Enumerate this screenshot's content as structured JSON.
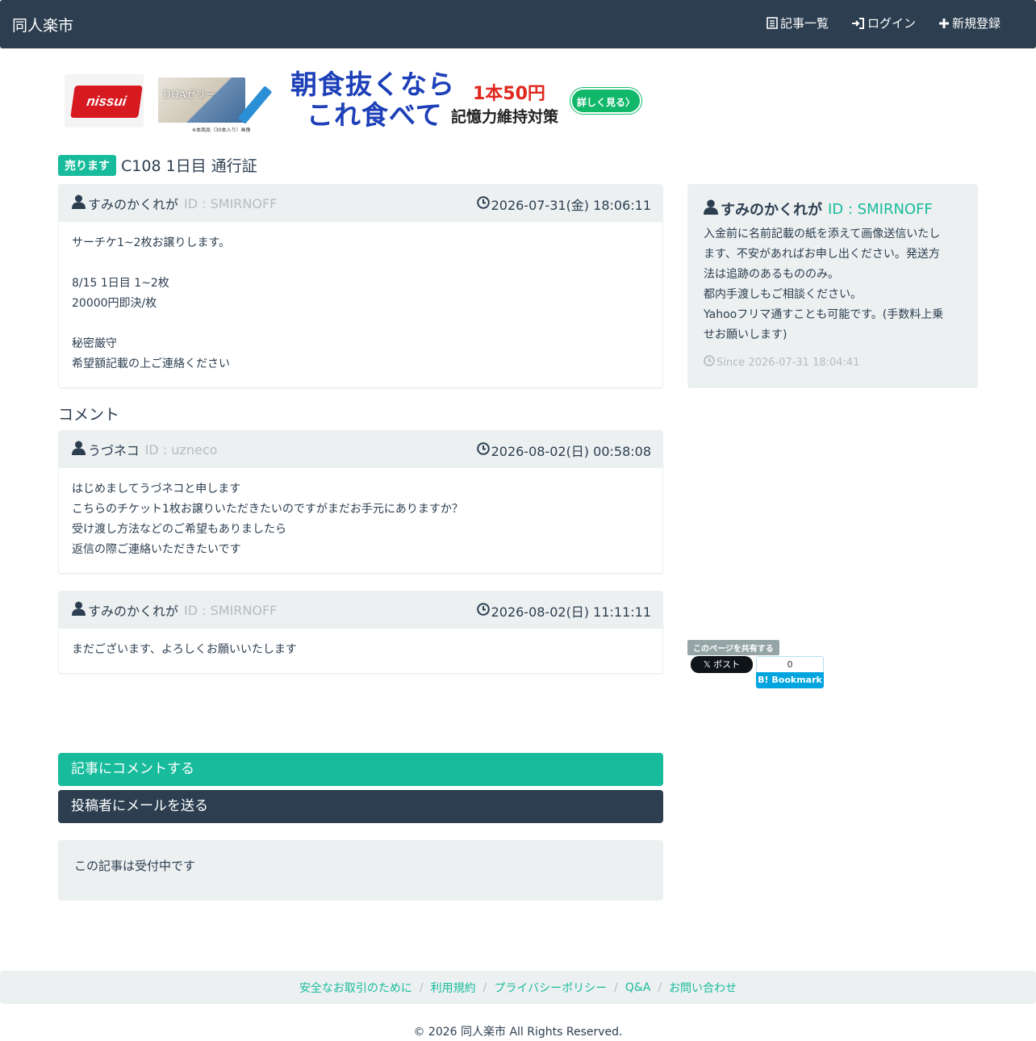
{
  "header": {
    "brand": "同人楽市",
    "nav": [
      {
        "label": "記事一覧",
        "icon": "list-icon"
      },
      {
        "label": "ログイン",
        "icon": "login-icon"
      },
      {
        "label": "新規登録",
        "icon": "plus-icon"
      }
    ]
  },
  "ad": {
    "logo_text": "nissui",
    "product_text": "DHAゼリー",
    "product_note": "※本商品（30本入り）画像",
    "headline_line1": "朝食抜くなら",
    "headline_line2": "これ食べて",
    "price": "1本50円",
    "subcopy": "記憶力維持対策",
    "cta": "詳しく見る〉"
  },
  "post": {
    "badge": "売ります",
    "title": "C108 1日目 通行証",
    "author": "すみのかくれが",
    "author_id": "ID : SMIRNOFF",
    "date": "2026-07-31(金) 18:06:11",
    "body_lines": [
      "サーチケ1~2枚お譲りします。",
      "",
      "8/15 1日目 1~2枚",
      "20000円即決/枚",
      "",
      "秘密厳守",
      "希望額記載の上ご連絡ください"
    ]
  },
  "comments_label": "コメント",
  "comments": [
    {
      "author": "うづネコ",
      "author_id": "ID : uzneco",
      "date": "2026-08-02(日) 00:58:08",
      "lines": [
        "はじめましてうづネコと申します",
        "こちらのチケット1枚お譲りいただきたいのですがまだお手元にありますか？",
        "受け渡し方法などのご希望もありましたら",
        "返信の際ご連絡いただきたいです"
      ]
    },
    {
      "author": "すみのかくれが",
      "author_id": "ID : SMIRNOFF",
      "date": "2026-08-02(日) 11:11:11",
      "lines": [
        "まだございます、よろしくお願いいたします"
      ]
    }
  ],
  "sidebar": {
    "name": "すみのかくれが",
    "user_id": "ID : SMIRNOFF",
    "bio_lines": [
      "入金前に名前記載の紙を添えて画像送信いたし",
      "ます、不安があればお申し出ください。発送方",
      "法は追跡のあるもののみ。",
      "都内手渡しもご相談ください。",
      "Yahooフリマ通すことも可能です。(手数料上乗",
      "せお願いします)"
    ],
    "since": "Since 2026-07-31 18:04:41",
    "share_label": "このページを共有する",
    "x_post": "𝕏 ポスト",
    "hatena_count": "0",
    "hatena_label": "B! Bookmark"
  },
  "actions": {
    "comment_btn": "記事にコメントする",
    "mail_btn": "投稿者にメールを送る",
    "status": "この記事は受付中です"
  },
  "footer": {
    "links": [
      "安全なお取引のために",
      "利用規約",
      "プライバシーポリシー",
      "Q&A",
      "お問い合わせ"
    ],
    "copyright": "© 2026 同人楽市 All Rights Reserved."
  },
  "colors": {
    "navbar": "#2c3e50",
    "accent": "#18bc9c",
    "muted": "#b4bcc2",
    "panel_bg": "#ecf0f1"
  }
}
